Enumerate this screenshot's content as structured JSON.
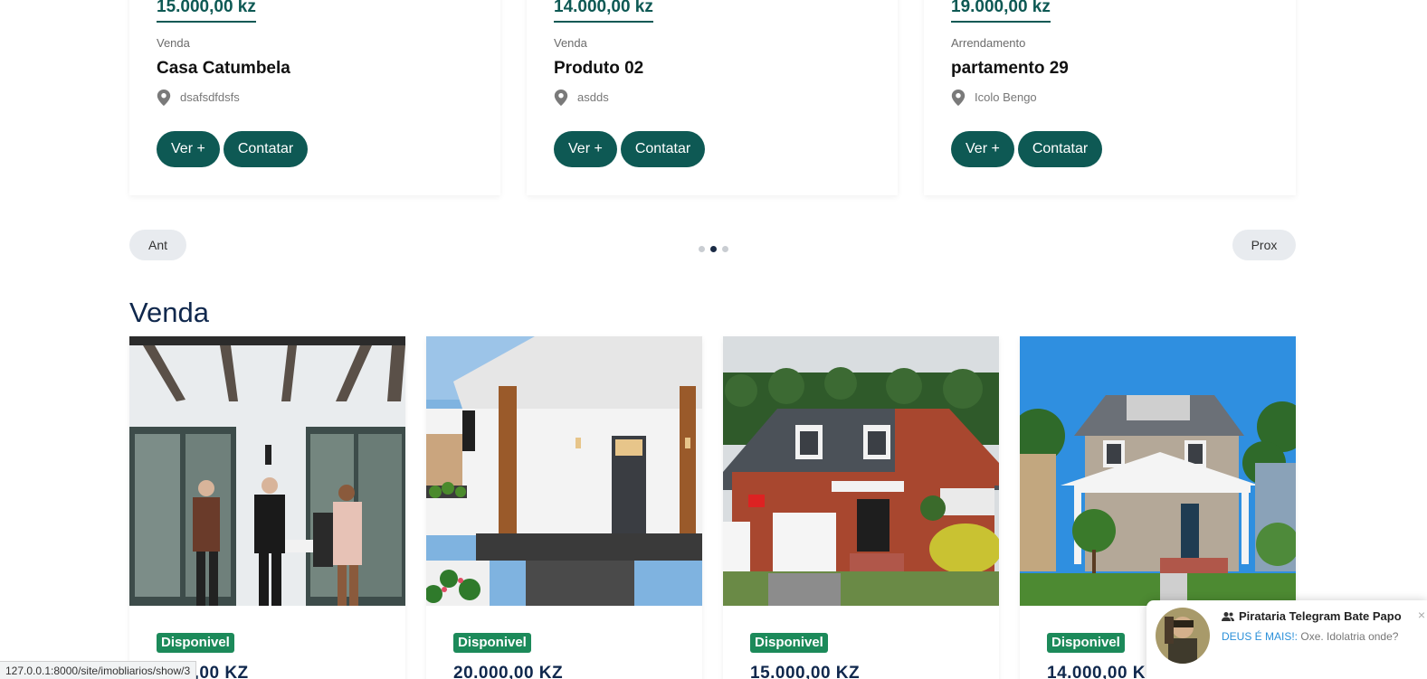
{
  "carousel": {
    "cards": [
      {
        "price": "15.000,00 kz",
        "type": "Venda",
        "title": "Casa Catumbela",
        "location": "dsafsdfdsfs",
        "view_label": "Ver +",
        "contact_label": "Contatar"
      },
      {
        "price": "14.000,00 kz",
        "type": "Venda",
        "title": "Produto 02",
        "location": "asdds",
        "view_label": "Ver +",
        "contact_label": "Contatar"
      },
      {
        "price": "19.000,00 kz",
        "type": "Arrendamento",
        "title": "partamento 29",
        "location": "Icolo Bengo",
        "view_label": "Ver +",
        "contact_label": "Contatar"
      }
    ],
    "prev_label": "Ant",
    "next_label": "Prox",
    "dots_total": 3,
    "dots_active": 2
  },
  "section": {
    "title": "Venda",
    "listings": [
      {
        "badge": "Disponivel",
        "price": "…00,00 KZ",
        "image": "people-at-white-house-entrance"
      },
      {
        "badge": "Disponivel",
        "price": "20.000,00 KZ",
        "image": "white-brick-porch-224"
      },
      {
        "badge": "Disponivel",
        "price": "15.000,00 KZ",
        "image": "brick-house-with-garage"
      },
      {
        "badge": "Disponivel",
        "price": "14.000,00 K…",
        "image": "gray-two-story-house"
      }
    ]
  },
  "statusbar": {
    "url": "127.0.0.1:8000/site/imobliarios/show/3"
  },
  "notification": {
    "title": "Pirataria Telegram Bate Papo",
    "sender": "DEUS É MAIS!:",
    "message": " Oxe. Idolatria onde?",
    "close": "×"
  },
  "colors": {
    "primary": "#0e5954",
    "heading": "#10284d",
    "badge": "#1c8a5a"
  }
}
